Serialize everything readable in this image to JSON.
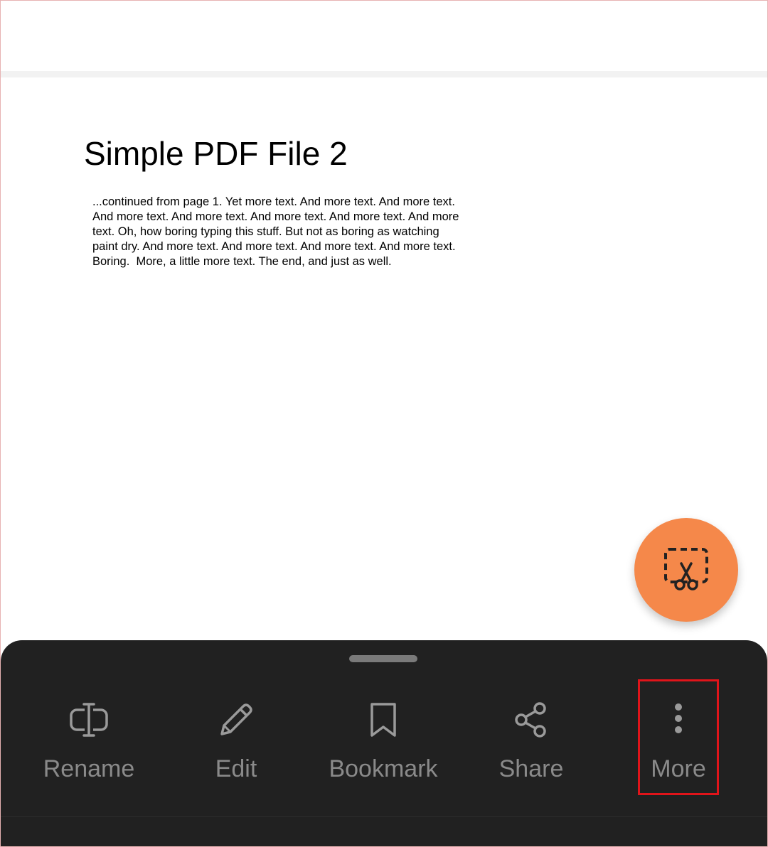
{
  "document": {
    "title": "Simple PDF File 2",
    "body_lines": [
      "...continued from page 1. Yet more text. And more text. And more text.",
      "And more text. And more text. And more text. And more text. And more",
      "text. Oh, how boring typing this stuff. But not as boring as watching",
      "paint dry. And more text. And more text. And more text. And more text.",
      "Boring.  More, a little more text. The end, and just as well."
    ]
  },
  "fab": {
    "icon": "screenshot-scissors-icon",
    "color": "#f5884a"
  },
  "bottom_sheet": {
    "background": "#212121",
    "actions": [
      {
        "label": "Rename",
        "icon": "rename-icon"
      },
      {
        "label": "Edit",
        "icon": "pencil-icon"
      },
      {
        "label": "Bookmark",
        "icon": "bookmark-icon"
      },
      {
        "label": "Share",
        "icon": "share-icon"
      },
      {
        "label": "More",
        "icon": "more-vertical-icon"
      }
    ]
  },
  "highlight_color": "#e0141a"
}
